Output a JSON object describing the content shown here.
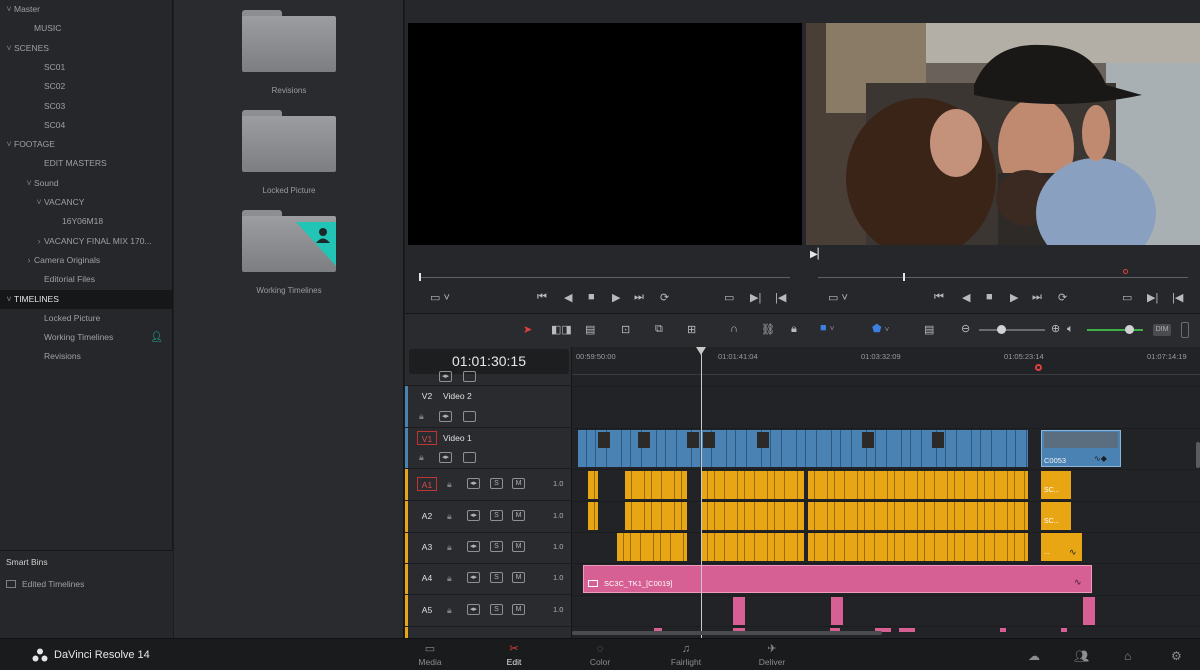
{
  "app": {
    "name": "DaVinci Resolve 14"
  },
  "bins": {
    "items": [
      {
        "label": "Master",
        "caret": "v",
        "indent": 0
      },
      {
        "label": "MUSIC",
        "caret": "",
        "indent": 1
      },
      {
        "label": "SCENES",
        "caret": "v",
        "indent": 0
      },
      {
        "label": "SC01",
        "caret": "",
        "indent": 2
      },
      {
        "label": "SC02",
        "caret": "",
        "indent": 2
      },
      {
        "label": "SC03",
        "caret": "",
        "indent": 2
      },
      {
        "label": "SC04",
        "caret": "",
        "indent": 2
      },
      {
        "label": "FOOTAGE",
        "caret": "v",
        "indent": 0
      },
      {
        "label": "EDIT MASTERS",
        "caret": "",
        "indent": 2
      },
      {
        "label": "Sound",
        "caret": "v",
        "indent": 1
      },
      {
        "label": "VACANCY",
        "caret": "v",
        "indent": 2
      },
      {
        "label": "16Y06M18",
        "caret": "",
        "indent": 3
      },
      {
        "label": "VACANCY FINAL MIX 170...",
        "caret": ">",
        "indent": 2
      },
      {
        "label": "Camera Originals",
        "caret": ">",
        "indent": 1
      },
      {
        "label": "Editorial Files",
        "caret": "",
        "indent": 2
      },
      {
        "label": "TIMELINES",
        "caret": "v",
        "indent": 0,
        "selected": true
      },
      {
        "label": "Locked Picture",
        "caret": "",
        "indent": 2
      },
      {
        "label": "Working Timelines",
        "caret": "",
        "indent": 2,
        "shared": true
      },
      {
        "label": "Revisions",
        "caret": "",
        "indent": 2
      }
    ],
    "smart_bins_title": "Smart Bins",
    "smart_bins": [
      {
        "label": "Edited Timelines"
      }
    ]
  },
  "media_pool": {
    "folders": [
      {
        "label": "Revisions"
      },
      {
        "label": "Locked Picture"
      },
      {
        "label": "Working Timelines",
        "shared": true
      }
    ]
  },
  "timeline": {
    "timecode": "01:01:30:15",
    "ruler": [
      "00:59:50:00",
      "01:01:41:04",
      "01:03:32:09",
      "01:05:23:14",
      "01:07:14:19"
    ],
    "tracks": {
      "v2": {
        "label": "V2",
        "name": "Video 2"
      },
      "v1": {
        "label": "V1",
        "name": "Video 1"
      },
      "audio": [
        {
          "label": "A1",
          "level": "1.0"
        },
        {
          "label": "A2",
          "level": "1.0"
        },
        {
          "label": "A3",
          "level": "1.0"
        },
        {
          "label": "A4",
          "level": "1.0"
        },
        {
          "label": "A5",
          "level": "1.0"
        }
      ]
    },
    "clips": {
      "video_end": "C0053",
      "audio_end_1": "SC...",
      "audio_end_2": "SC...",
      "audio_end_3": "...",
      "pink": "SC3C_TK1_[C0019]"
    },
    "track_buttons": {
      "s": "S",
      "m": "M"
    },
    "dim": "DIM"
  },
  "pages": [
    {
      "label": "Media",
      "icon": "media-icon"
    },
    {
      "label": "Edit",
      "icon": "edit-icon",
      "active": true
    },
    {
      "label": "Color",
      "icon": "color-icon"
    },
    {
      "label": "Fairlight",
      "icon": "fairlight-icon"
    },
    {
      "label": "Deliver",
      "icon": "deliver-icon"
    }
  ],
  "colors": {
    "accent_teal": "#22c4b6",
    "video_clip": "#4a82b4",
    "audio_clip": "#e8a615",
    "pink_clip": "#d65f93",
    "playhead_red": "#c03434"
  }
}
